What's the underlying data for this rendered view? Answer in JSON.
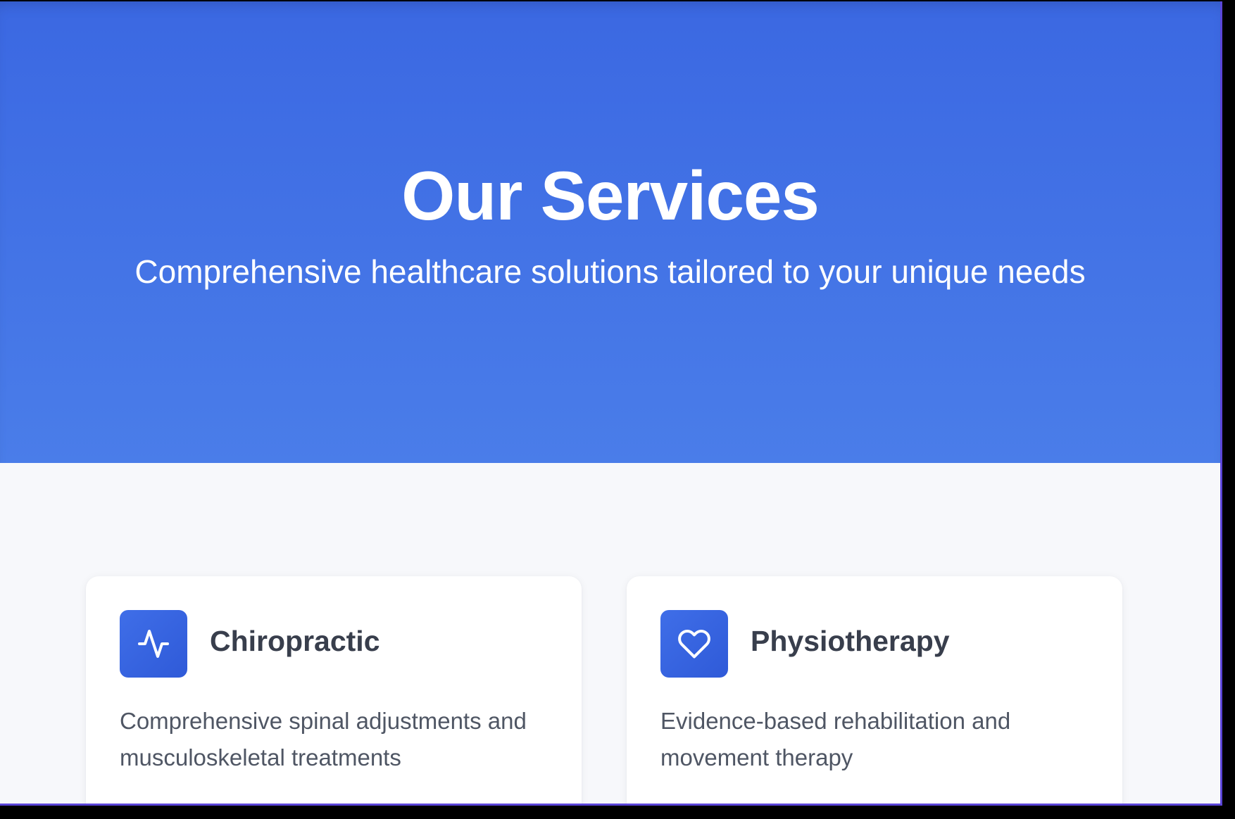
{
  "hero": {
    "title": "Our Services",
    "subtitle": "Comprehensive healthcare solutions tailored to your unique needs"
  },
  "services": [
    {
      "title": "Chiropractic",
      "description": "Comprehensive spinal adjustments and musculoskeletal treatments",
      "icon": "activity-icon"
    },
    {
      "title": "Physiotherapy",
      "description": "Evidence-based rehabilitation and movement therapy",
      "icon": "heart-icon"
    }
  ],
  "colors": {
    "hero_start": "#3b68e2",
    "hero_end": "#4a7de9",
    "icon_bg": "#3f6ee8",
    "page_bg": "#f7f8fb"
  }
}
